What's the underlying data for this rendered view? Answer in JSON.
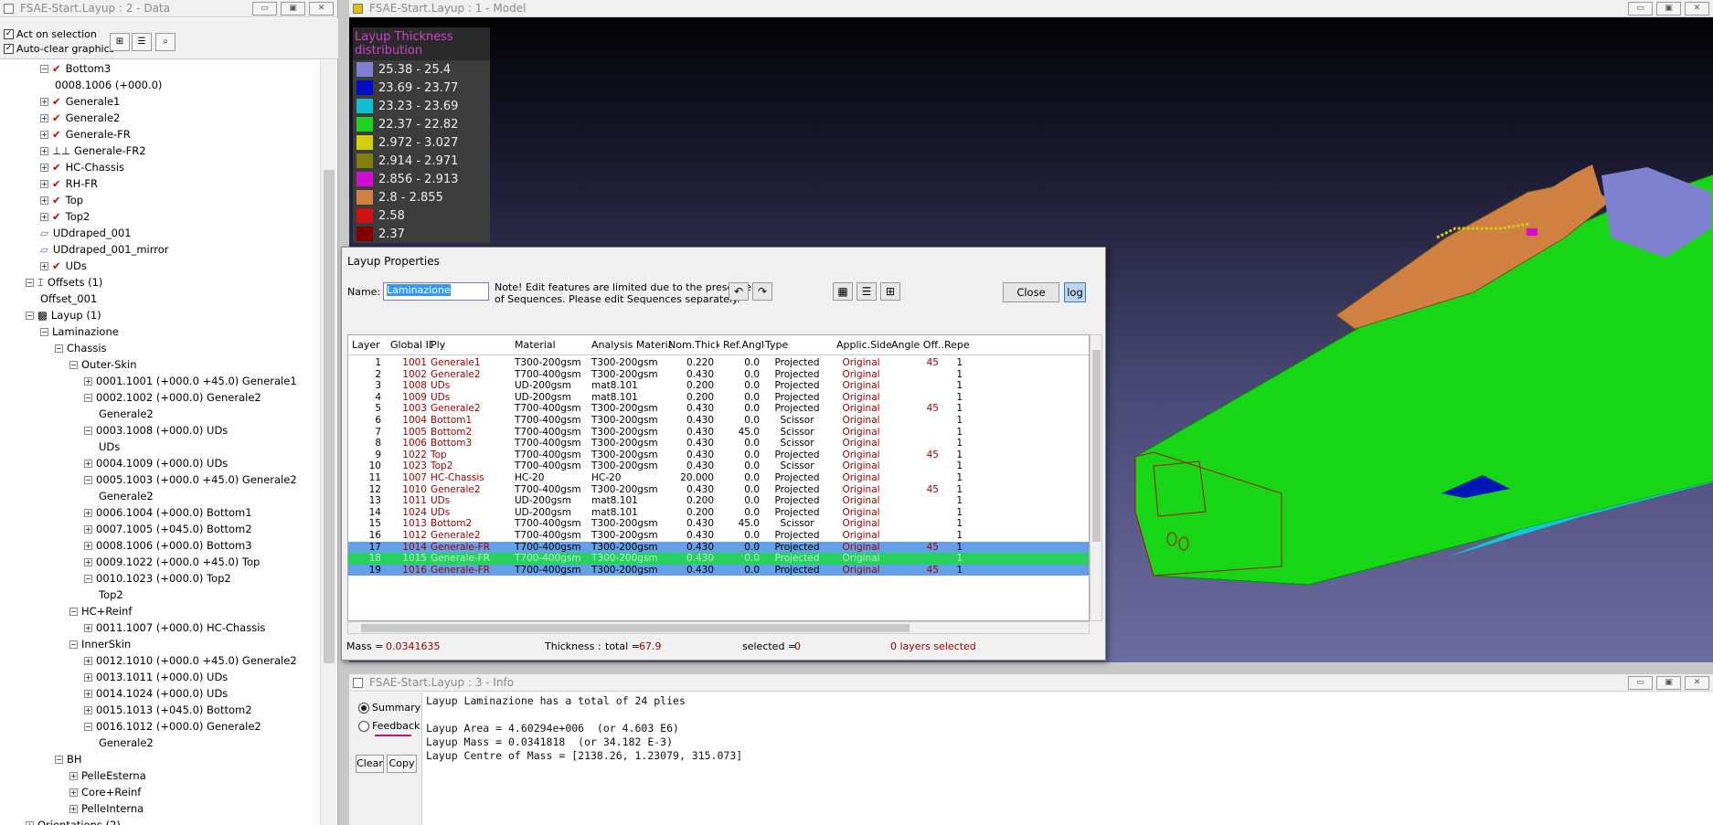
{
  "data_window": {
    "title": "FSAE-Start.Layup : 2 - Data",
    "act_on_selection": "Act on selection",
    "auto_clear": "Auto-clear graphics",
    "tree": [
      {
        "label": "Bottom3",
        "level": 2,
        "exp": "-",
        "mark": "check"
      },
      {
        "label": "0008.1006 (+000.0)",
        "level": 3,
        "exp": "",
        "mark": ""
      },
      {
        "label": "Generale1",
        "level": 2,
        "exp": "+",
        "mark": "check"
      },
      {
        "label": "Generale2",
        "level": 2,
        "exp": "+",
        "mark": "check"
      },
      {
        "label": "Generale-FR",
        "level": 2,
        "exp": "+",
        "mark": "check"
      },
      {
        "label": "Generale-FR2",
        "level": 2,
        "exp": "+",
        "mark": "draped"
      },
      {
        "label": "HC-Chassis",
        "level": 2,
        "exp": "+",
        "mark": "check"
      },
      {
        "label": "RH-FR",
        "level": 2,
        "exp": "+",
        "mark": "check"
      },
      {
        "label": "Top",
        "level": 2,
        "exp": "+",
        "mark": "check"
      },
      {
        "label": "Top2",
        "level": 2,
        "exp": "+",
        "mark": "check"
      },
      {
        "label": "UDdraped_001",
        "level": 2,
        "exp": "",
        "mark": "ud"
      },
      {
        "label": "UDdraped_001_mirror",
        "level": 2,
        "exp": "",
        "mark": "ud"
      },
      {
        "label": "UDs",
        "level": 2,
        "exp": "+",
        "mark": "check"
      },
      {
        "label": "Offsets (1)",
        "level": 1,
        "exp": "-",
        "mark": "off"
      },
      {
        "label": "Offset_001",
        "level": 2,
        "exp": "",
        "mark": ""
      },
      {
        "label": "Layup (1)",
        "level": 1,
        "exp": "-",
        "mark": "lay"
      },
      {
        "label": "Laminazione",
        "level": 2,
        "exp": "-",
        "mark": ""
      },
      {
        "label": "Chassis",
        "level": 3,
        "exp": "-",
        "mark": ""
      },
      {
        "label": "Outer-Skin",
        "level": 4,
        "exp": "-",
        "mark": ""
      },
      {
        "label": "0001.1001 (+000.0 +45.0)  Generale1",
        "level": 5,
        "exp": "+",
        "mark": ""
      },
      {
        "label": "0002.1002 (+000.0)  Generale2",
        "level": 5,
        "exp": "-",
        "mark": ""
      },
      {
        "label": "Generale2",
        "level": 6,
        "exp": "",
        "mark": ""
      },
      {
        "label": "0003.1008 (+000.0)  UDs",
        "level": 5,
        "exp": "-",
        "mark": ""
      },
      {
        "label": "UDs",
        "level": 6,
        "exp": "",
        "mark": ""
      },
      {
        "label": "0004.1009 (+000.0)  UDs",
        "level": 5,
        "exp": "+",
        "mark": ""
      },
      {
        "label": "0005.1003 (+000.0 +45.0)  Generale2",
        "level": 5,
        "exp": "-",
        "mark": ""
      },
      {
        "label": "Generale2",
        "level": 6,
        "exp": "",
        "mark": ""
      },
      {
        "label": "0006.1004 (+000.0)  Bottom1",
        "level": 5,
        "exp": "+",
        "mark": ""
      },
      {
        "label": "0007.1005 (+045.0)  Bottom2",
        "level": 5,
        "exp": "+",
        "mark": ""
      },
      {
        "label": "0008.1006 (+000.0)  Bottom3",
        "level": 5,
        "exp": "+",
        "mark": ""
      },
      {
        "label": "0009.1022 (+000.0 +45.0)  Top",
        "level": 5,
        "exp": "+",
        "mark": ""
      },
      {
        "label": "0010.1023 (+000.0)  Top2",
        "level": 5,
        "exp": "-",
        "mark": ""
      },
      {
        "label": "Top2",
        "level": 6,
        "exp": "",
        "mark": ""
      },
      {
        "label": "HC+Reinf",
        "level": 4,
        "exp": "-",
        "mark": ""
      },
      {
        "label": "0011.1007 (+000.0)  HC-Chassis",
        "level": 5,
        "exp": "+",
        "mark": ""
      },
      {
        "label": "InnerSkin",
        "level": 4,
        "exp": "-",
        "mark": ""
      },
      {
        "label": "0012.1010 (+000.0 +45.0)  Generale2",
        "level": 5,
        "exp": "+",
        "mark": ""
      },
      {
        "label": "0013.1011 (+000.0)  UDs",
        "level": 5,
        "exp": "+",
        "mark": ""
      },
      {
        "label": "0014.1024 (+000.0)  UDs",
        "level": 5,
        "exp": "+",
        "mark": ""
      },
      {
        "label": "0015.1013 (+045.0)  Bottom2",
        "level": 5,
        "exp": "+",
        "mark": ""
      },
      {
        "label": "0016.1012 (+000.0)  Generale2",
        "level": 5,
        "exp": "-",
        "mark": ""
      },
      {
        "label": "Generale2",
        "level": 6,
        "exp": "",
        "mark": ""
      },
      {
        "label": "BH",
        "level": 3,
        "exp": "-",
        "mark": ""
      },
      {
        "label": "PelleEsterna",
        "level": 4,
        "exp": "+",
        "mark": ""
      },
      {
        "label": "Core+Reinf",
        "level": 4,
        "exp": "+",
        "mark": ""
      },
      {
        "label": "PelleInterna",
        "level": 4,
        "exp": "+",
        "mark": ""
      },
      {
        "label": "Orientations (2)",
        "level": 1,
        "exp": "+",
        "mark": ""
      }
    ]
  },
  "model_window": {
    "title": "FSAE-Start.Layup : 1 - Model",
    "legend_title": "Layup Thickness distribution",
    "legend": [
      {
        "label": "25.38 - 25.4",
        "color": "#8080d0"
      },
      {
        "label": "23.69 - 23.77",
        "color": "#0010c0"
      },
      {
        "label": "23.23 - 23.69",
        "color": "#10c0d0"
      },
      {
        "label": "22.37 - 22.82",
        "color": "#20d020"
      },
      {
        "label": "2.972 - 3.027",
        "color": "#d0d010"
      },
      {
        "label": "2.914 - 2.971",
        "color": "#808010"
      },
      {
        "label": "2.856 - 2.913",
        "color": "#d010d0"
      },
      {
        "label": "2.8 - 2.855",
        "color": "#d08040"
      },
      {
        "label": "2.58",
        "color": "#d01010"
      },
      {
        "label": "2.37",
        "color": "#800000"
      }
    ]
  },
  "info_window": {
    "title": "FSAE-Start.Layup : 3 - Info",
    "summary": "Summary",
    "feedback": "Feedback",
    "clear": "Clear",
    "copy": "Copy",
    "text": "Layup Laminazione has a total of 24 plies\n\nLayup Area = 4.60294e+006  (or 4.603 E6)\nLayup Mass = 0.0341818  (or 34.182 E-3)\nLayup Centre of Mass = [2138.26, 1.23079, 315.073]"
  },
  "dialog": {
    "title": "Layup Properties",
    "name_label": "Name:",
    "name_value": "Laminazione",
    "note1": "Note!  Edit features are limited due to the presence",
    "note2": "of Sequences. Please edit Sequences separately.",
    "close": "Close",
    "log": "log",
    "columns": [
      "Layer",
      "Global ID",
      "Ply",
      "Material",
      "Analysis Material",
      "Nom.Thick.",
      "Ref.Angle",
      "Type",
      "Applic.Side",
      "Angle Off...",
      "Repe"
    ],
    "rows": [
      [
        "1",
        "1001",
        "Generale1",
        "T300-200gsm",
        "T300-200gsm",
        "0.220",
        "0.0",
        "Projected",
        "Original",
        "45",
        "1"
      ],
      [
        "2",
        "1002",
        "Generale2",
        "T700-400gsm",
        "T300-200gsm",
        "0.430",
        "0.0",
        "Projected",
        "Original",
        "",
        "1"
      ],
      [
        "3",
        "1008",
        "UDs",
        "UD-200gsm",
        "mat8.101",
        "0.200",
        "0.0",
        "Projected",
        "Original",
        "",
        "1"
      ],
      [
        "4",
        "1009",
        "UDs",
        "UD-200gsm",
        "mat8.101",
        "0.200",
        "0.0",
        "Projected",
        "Original",
        "",
        "1"
      ],
      [
        "5",
        "1003",
        "Generale2",
        "T700-400gsm",
        "T300-200gsm",
        "0.430",
        "0.0",
        "Projected",
        "Original",
        "45",
        "1"
      ],
      [
        "6",
        "1004",
        "Bottom1",
        "T700-400gsm",
        "T300-200gsm",
        "0.430",
        "0.0",
        "Scissor",
        "Original",
        "",
        "1"
      ],
      [
        "7",
        "1005",
        "Bottom2",
        "T700-400gsm",
        "T300-200gsm",
        "0.430",
        "45.0",
        "Scissor",
        "Original",
        "",
        "1"
      ],
      [
        "8",
        "1006",
        "Bottom3",
        "T700-400gsm",
        "T300-200gsm",
        "0.430",
        "0.0",
        "Scissor",
        "Original",
        "",
        "1"
      ],
      [
        "9",
        "1022",
        "Top",
        "T700-400gsm",
        "T300-200gsm",
        "0.430",
        "0.0",
        "Projected",
        "Original",
        "45",
        "1"
      ],
      [
        "10",
        "1023",
        "Top2",
        "T700-400gsm",
        "T300-200gsm",
        "0.430",
        "0.0",
        "Scissor",
        "Original",
        "",
        "1"
      ],
      [
        "11",
        "1007",
        "HC-Chassis",
        "HC-20",
        "HC-20",
        "20.000",
        "0.0",
        "Projected",
        "Original",
        "",
        "1"
      ],
      [
        "12",
        "1010",
        "Generale2",
        "T700-400gsm",
        "T300-200gsm",
        "0.430",
        "0.0",
        "Projected",
        "Original",
        "45",
        "1"
      ],
      [
        "13",
        "1011",
        "UDs",
        "UD-200gsm",
        "mat8.101",
        "0.200",
        "0.0",
        "Projected",
        "Original",
        "",
        "1"
      ],
      [
        "14",
        "1024",
        "UDs",
        "UD-200gsm",
        "mat8.101",
        "0.200",
        "0.0",
        "Projected",
        "Original",
        "",
        "1"
      ],
      [
        "15",
        "1013",
        "Bottom2",
        "T700-400gsm",
        "T300-200gsm",
        "0.430",
        "45.0",
        "Scissor",
        "Original",
        "",
        "1"
      ],
      [
        "16",
        "1012",
        "Generale2",
        "T700-400gsm",
        "T300-200gsm",
        "0.430",
        "0.0",
        "Projected",
        "Original",
        "",
        "1"
      ],
      [
        "17",
        "1014",
        "Generale-FR",
        "T700-400gsm",
        "T300-200gsm",
        "0.430",
        "0.0",
        "Projected",
        "Original",
        "45",
        "1"
      ],
      [
        "18",
        "1015",
        "Generale-FR",
        "T700-400gsm",
        "T300-200gsm",
        "0.430",
        "0.0",
        "Projected",
        "Original",
        "",
        "1"
      ],
      [
        "19",
        "1016",
        "Generale-FR",
        "T700-400gsm",
        "T300-200gsm",
        "0.430",
        "0.0",
        "Projected",
        "Original",
        "45",
        "1"
      ]
    ],
    "mass_label": "Mass =",
    "mass_value": "0.0341635",
    "thickness_label": "Thickness :",
    "total_label": "total =",
    "total_value": "67.9",
    "selected_label": "selected =",
    "selected_value": "0",
    "layers_selected": "0 layers selected"
  }
}
